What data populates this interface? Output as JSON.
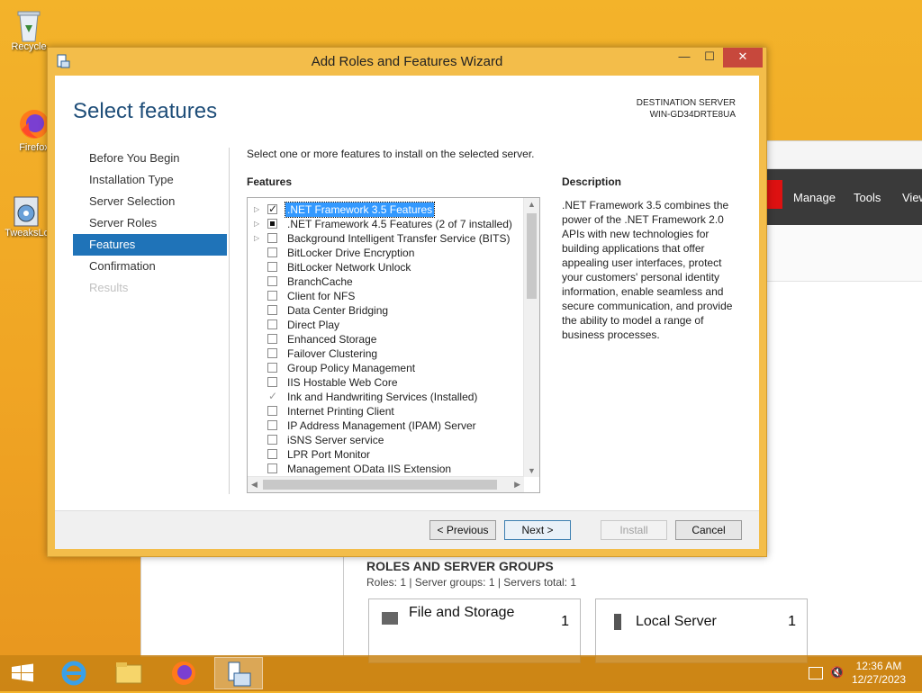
{
  "desktop": {
    "icons": [
      {
        "label": "Recycle"
      },
      {
        "label": "Firefox"
      },
      {
        "label": "TweaksLo"
      }
    ]
  },
  "server_manager": {
    "menu": [
      "Manage",
      "Tools",
      "View"
    ],
    "roles_title": "ROLES AND SERVER GROUPS",
    "roles_sub": "Roles: 1   |   Server groups: 1   |   Servers total: 1",
    "tiles": [
      {
        "name": "File and Storage",
        "count": "1"
      },
      {
        "name": "Local Server",
        "count": "1"
      }
    ]
  },
  "wizard": {
    "title": "Add Roles and Features Wizard",
    "controls": {
      "minimize": "—",
      "maximize": "☐",
      "close": "✕"
    },
    "page_title": "Select features",
    "destination_label": "DESTINATION SERVER",
    "destination_value": "WIN-GD34DRTE8UA",
    "nav": [
      {
        "label": "Before You Begin",
        "state": "normal"
      },
      {
        "label": "Installation Type",
        "state": "normal"
      },
      {
        "label": "Server Selection",
        "state": "normal"
      },
      {
        "label": "Server Roles",
        "state": "normal"
      },
      {
        "label": "Features",
        "state": "active"
      },
      {
        "label": "Confirmation",
        "state": "normal"
      },
      {
        "label": "Results",
        "state": "disabled"
      }
    ],
    "instruction": "Select one or more features to install on the selected server.",
    "features_label": "Features",
    "description_label": "Description",
    "description": ".NET Framework 3.5 combines the power of the .NET Framework 2.0 APIs with new technologies for building applications that offer appealing user interfaces, protect your customers' personal identity information, enable seamless and secure communication, and provide the ability to model a range of business processes.",
    "features": [
      {
        "label": ".NET Framework 3.5 Features",
        "check": "checked",
        "expandable": true,
        "selected": true
      },
      {
        "label": ".NET Framework 4.5 Features (2 of 7 installed)",
        "check": "partial",
        "expandable": true,
        "selected": false
      },
      {
        "label": "Background Intelligent Transfer Service (BITS)",
        "check": "unchecked",
        "expandable": true,
        "selected": false
      },
      {
        "label": "BitLocker Drive Encryption",
        "check": "unchecked",
        "expandable": false,
        "selected": false
      },
      {
        "label": "BitLocker Network Unlock",
        "check": "unchecked",
        "expandable": false,
        "selected": false
      },
      {
        "label": "BranchCache",
        "check": "unchecked",
        "expandable": false,
        "selected": false
      },
      {
        "label": "Client for NFS",
        "check": "unchecked",
        "expandable": false,
        "selected": false
      },
      {
        "label": "Data Center Bridging",
        "check": "unchecked",
        "expandable": false,
        "selected": false
      },
      {
        "label": "Direct Play",
        "check": "unchecked",
        "expandable": false,
        "selected": false
      },
      {
        "label": "Enhanced Storage",
        "check": "unchecked",
        "expandable": false,
        "selected": false
      },
      {
        "label": "Failover Clustering",
        "check": "unchecked",
        "expandable": false,
        "selected": false
      },
      {
        "label": "Group Policy Management",
        "check": "unchecked",
        "expandable": false,
        "selected": false
      },
      {
        "label": "IIS Hostable Web Core",
        "check": "unchecked",
        "expandable": false,
        "selected": false
      },
      {
        "label": "Ink and Handwriting Services (Installed)",
        "check": "disabled-checked",
        "expandable": false,
        "selected": false
      },
      {
        "label": "Internet Printing Client",
        "check": "unchecked",
        "expandable": false,
        "selected": false
      },
      {
        "label": "IP Address Management (IPAM) Server",
        "check": "unchecked",
        "expandable": false,
        "selected": false
      },
      {
        "label": "iSNS Server service",
        "check": "unchecked",
        "expandable": false,
        "selected": false
      },
      {
        "label": "LPR Port Monitor",
        "check": "unchecked",
        "expandable": false,
        "selected": false
      },
      {
        "label": "Management OData IIS Extension",
        "check": "unchecked",
        "expandable": false,
        "selected": false
      }
    ],
    "buttons": {
      "previous": "< Previous",
      "next": "Next >",
      "install": "Install",
      "cancel": "Cancel"
    }
  },
  "taskbar": {
    "time": "12:36 AM",
    "date": "12/27/2023"
  },
  "colors": {
    "accent": "#1f73b8",
    "title_blue": "#1f4e79",
    "selection": "#3399ff",
    "window_frame": "#f3bd4a"
  }
}
